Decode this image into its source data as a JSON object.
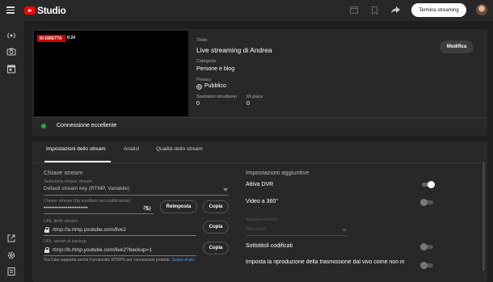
{
  "header": {
    "logo_text": "Studio",
    "end_stream_label": "Termina streaming"
  },
  "preview": {
    "live_badge": "IN DIRETTA",
    "elapsed": "0:24"
  },
  "stream_info": {
    "title_label": "Titolo",
    "title_value": "Live streaming di Andrea",
    "category_label": "Categoria",
    "category_value": "Persone e blog",
    "privacy_label": "Privacy",
    "privacy_value": "Pubblico",
    "viewers_label": "Spettatori simultanei",
    "viewers_value": "0",
    "likes_label": "Mi piace",
    "likes_value": "0",
    "modify_label": "Modifica"
  },
  "connection": {
    "status": "Connessione eccellente",
    "status_color": "#2ba640"
  },
  "tabs": [
    {
      "label": "Impostazioni dello stream",
      "active": true
    },
    {
      "label": "Analisi",
      "active": false
    },
    {
      "label": "Qualità dello stream",
      "active": false
    }
  ],
  "stream_key": {
    "section_title": "Chiave stream",
    "select_label": "Seleziona chiave stream",
    "select_value": "Default stream key (RTMP, Variabile)",
    "key_label": "Chiave stream (da incollare nel codificatore)",
    "key_value": "••••••••••••••••••••••••",
    "reset_label": "Reimposta",
    "copy_label": "Copia",
    "url_label": "URL dello stream",
    "url_value": "rtmp://a.rtmp.youtube.com/live2",
    "backup_label": "URL server di backup",
    "backup_value": "rtmp://b.rtmp.youtube.com/live2?backup=1",
    "footnote": "YouTube supporta anche il protocollo RTMPS per connessioni protette.",
    "footnote_link": "Scopri di più"
  },
  "additional": {
    "section_title": "Impostazioni aggiuntive",
    "dvr_label": "Attiva DVR",
    "dvr_on": true,
    "vr_label": "Video a 360°",
    "vr_on": false,
    "delay_label": "Aggiunta ritardo",
    "delay_value": "Nessuno",
    "captions_label": "Sottotitoli codificati",
    "captions_on": false,
    "unlisted_label": "Imposta la riproduzione della trasmissione dal vivo come non in"
  }
}
